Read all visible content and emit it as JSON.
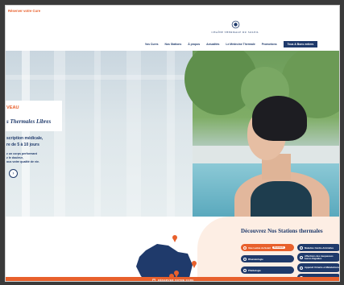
{
  "header": {
    "reserve_link": "Réserver votre Cure",
    "logo_text": "CHAÎNE THERMALE DU SOLEIL",
    "nav": [
      "Vos Cures",
      "Nos Stations",
      "À propos",
      "Actualités",
      "Le Médecine Thermale",
      "Promotions"
    ],
    "cta": "Tous & Bons entiers"
  },
  "hero": {
    "kicker": "VEAU",
    "title": "s Thermales Libres",
    "subtitle_line1": "scription médicale,",
    "subtitle_line2": "re de 5 à 10 jours",
    "body_lines": [
      "z un corps performant",
      "z le douleur,",
      "ous votre qualité de vie."
    ],
    "button_icon": "arrow-right-icon"
  },
  "stations": {
    "title": "Découvrez Nos Stations thermales",
    "pills_left": [
      {
        "label": "Voie Lactée du Soleil",
        "tag": "Nouveauté",
        "style": "orange"
      },
      {
        "label": "Rhumatologie",
        "style": "navy"
      },
      {
        "label": "Phlébologie",
        "style": "navy"
      }
    ],
    "pills_right": [
      {
        "label": "Maladies Cardio-Artérielles",
        "style": "navy"
      },
      {
        "label": "Affections des muqueuses bucco-linguales",
        "style": "navy"
      },
      {
        "label": "Appareil Urinaire et Métabolisme",
        "style": "navy"
      },
      {
        "label": "Dermatologie",
        "style": "navy"
      }
    ]
  },
  "footer_bar": {
    "label": "RÉSERVER VOTRE CURE"
  },
  "colors": {
    "accent": "#e8602c",
    "navy": "#1f3a6b"
  }
}
